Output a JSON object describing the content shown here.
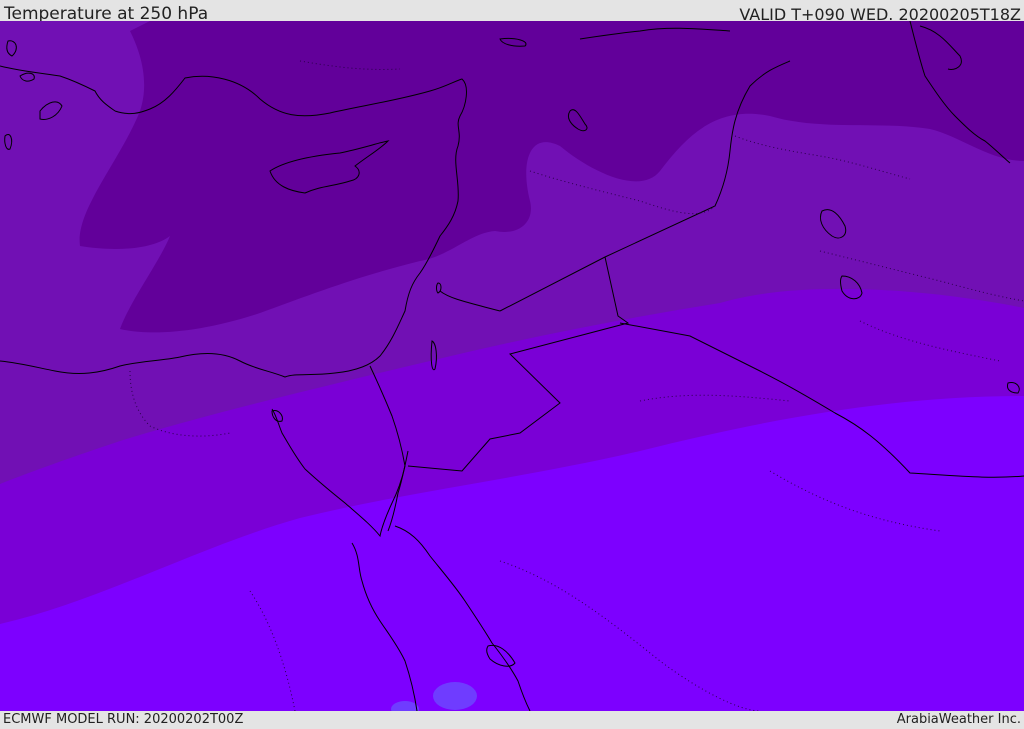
{
  "header": {
    "title": "Temperature at 250 hPa",
    "valid": "VALID T+090 WED. 20200205T18Z"
  },
  "footer": {
    "model_run": "ECMWF MODEL RUN: 20200202T00Z",
    "credit": "ArabiaWeather Inc."
  },
  "map": {
    "colors": {
      "coldest": "#62009a",
      "cold": "#7110b4",
      "mid": "#7a00d6",
      "warm": "#7d00ff",
      "patch": "#6f3cff",
      "coast": "#000000",
      "border_line": "#2a004a"
    }
  }
}
